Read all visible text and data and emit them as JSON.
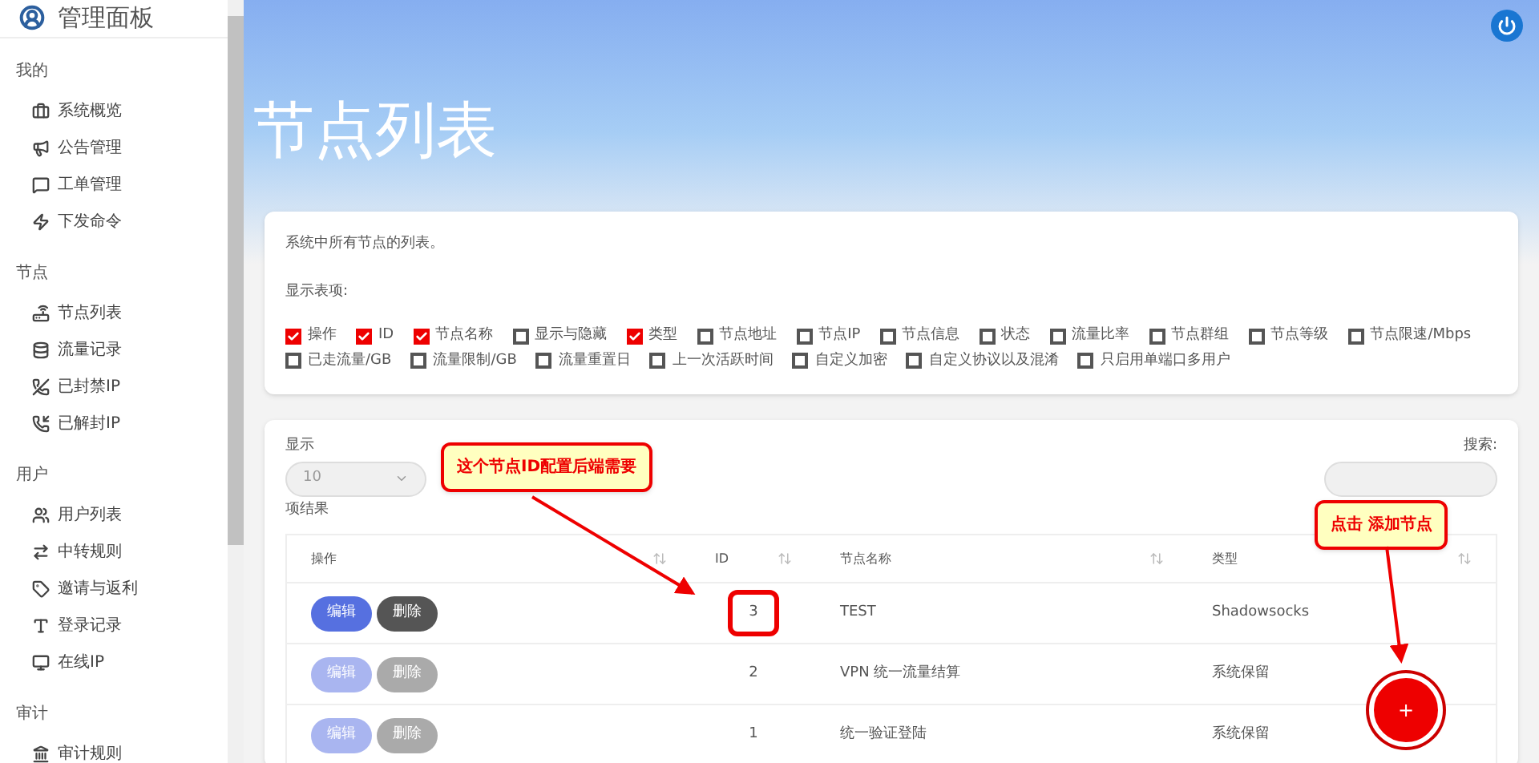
{
  "sidebar": {
    "title": "管理面板",
    "sections": [
      {
        "title": "我的",
        "items": [
          {
            "label": "系统概览"
          },
          {
            "label": "公告管理"
          },
          {
            "label": "工单管理"
          },
          {
            "label": "下发命令"
          }
        ]
      },
      {
        "title": "节点",
        "items": [
          {
            "label": "节点列表"
          },
          {
            "label": "流量记录"
          },
          {
            "label": "已封禁IP"
          },
          {
            "label": "已解封IP"
          }
        ]
      },
      {
        "title": "用户",
        "items": [
          {
            "label": "用户列表"
          },
          {
            "label": "中转规则"
          },
          {
            "label": "邀请与返利"
          },
          {
            "label": "登录记录"
          },
          {
            "label": "在线IP"
          }
        ]
      },
      {
        "title": "审计",
        "items": [
          {
            "label": "审计规则"
          }
        ]
      }
    ]
  },
  "page": {
    "title": "节点列表"
  },
  "columns_card": {
    "description": "系统中所有节点的列表。",
    "label": "显示表项:",
    "options": [
      {
        "label": "操作",
        "checked": true
      },
      {
        "label": "ID",
        "checked": true
      },
      {
        "label": "节点名称",
        "checked": true
      },
      {
        "label": "显示与隐藏",
        "checked": false
      },
      {
        "label": "类型",
        "checked": true
      },
      {
        "label": "节点地址",
        "checked": false
      },
      {
        "label": "节点IP",
        "checked": false
      },
      {
        "label": "节点信息",
        "checked": false
      },
      {
        "label": "状态",
        "checked": false
      },
      {
        "label": "流量比率",
        "checked": false
      },
      {
        "label": "节点群组",
        "checked": false
      },
      {
        "label": "节点等级",
        "checked": false
      },
      {
        "label": "节点限速/Mbps",
        "checked": false
      },
      {
        "label": "已走流量/GB",
        "checked": false
      },
      {
        "label": "流量限制/GB",
        "checked": false
      },
      {
        "label": "流量重置日",
        "checked": false
      },
      {
        "label": "上一次活跃时间",
        "checked": false
      },
      {
        "label": "自定义加密",
        "checked": false
      },
      {
        "label": "自定义协议以及混淆",
        "checked": false
      },
      {
        "label": "只启用单端口多用户",
        "checked": false
      }
    ]
  },
  "table_card": {
    "show_label": "显示",
    "page_size": "10",
    "results_label": "项结果",
    "search_label": "搜索:",
    "columns": [
      "操作",
      "ID",
      "节点名称",
      "类型"
    ],
    "rows": [
      {
        "edit": "编辑",
        "delete": "删除",
        "disabled": false,
        "id": "3",
        "highlighted": true,
        "name": "TEST",
        "type": "Shadowsocks"
      },
      {
        "edit": "编辑",
        "delete": "删除",
        "disabled": true,
        "id": "2",
        "highlighted": false,
        "name": "VPN 统一流量结算",
        "type": "系统保留"
      },
      {
        "edit": "编辑",
        "delete": "删除",
        "disabled": true,
        "id": "1",
        "highlighted": false,
        "name": "统一验证登陆",
        "type": "系统保留"
      }
    ],
    "add_button": "+"
  },
  "callouts": [
    "这个节点ID配置后端需要",
    "点击 添加节点"
  ]
}
